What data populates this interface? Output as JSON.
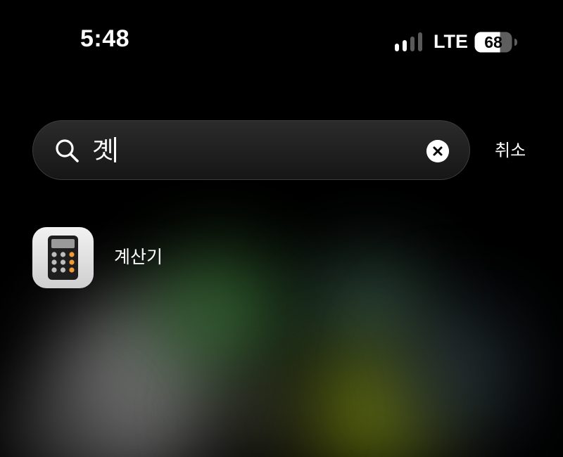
{
  "status_bar": {
    "time": "5:48",
    "network": "LTE",
    "battery_level": "68",
    "signal_bars_active": 2,
    "signal_bars_total": 4
  },
  "search": {
    "query": "곗",
    "clear_icon": "clear-x-icon",
    "search_icon": "magnifying-glass-icon"
  },
  "cancel_label": "취소",
  "results": [
    {
      "label": "계산기",
      "icon": "calculator-app-icon"
    }
  ],
  "colors": {
    "background": "#000000",
    "text": "#ffffff",
    "search_bg": "#1f1f1f",
    "calculator_orange": "#f19a37"
  }
}
